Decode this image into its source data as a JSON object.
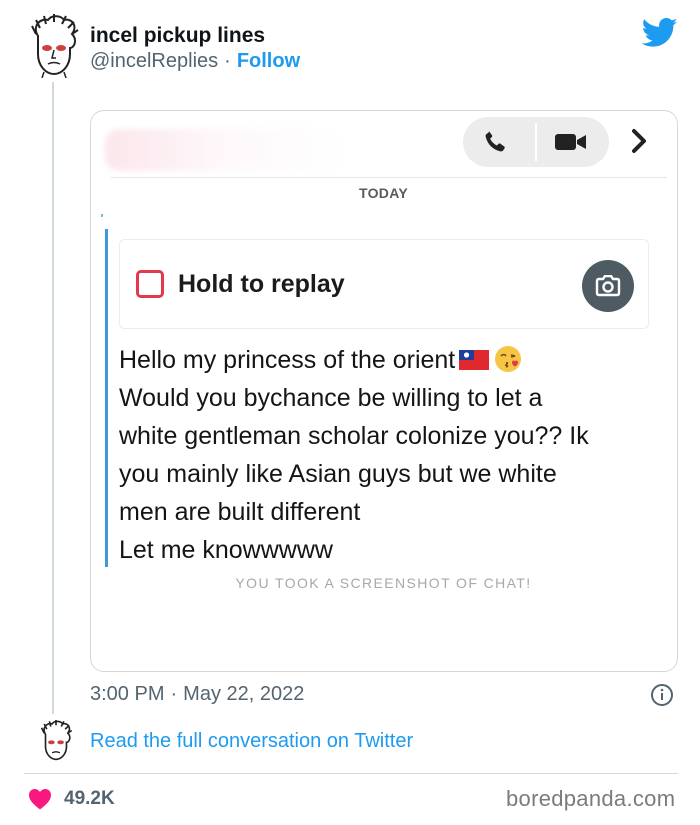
{
  "tweet": {
    "author_name": "incel pickup lines",
    "author_handle": "@incelReplies",
    "handle_separator": "·",
    "follow_label": "Follow",
    "time": "3:00 PM",
    "date_separator": "·",
    "date": "May 22, 2022",
    "read_more_label": "Read the full conversation on Twitter",
    "like_count": "49.2K",
    "brand_color": "#1d9bf0",
    "like_color": "#f91880"
  },
  "snap": {
    "day_label": "TODAY",
    "hold_label": "Hold to replay",
    "message_lines": [
      "Hello my princess of the orient",
      "Would you bychance be willing to let a",
      "white gentleman scholar colonize you?? Ik",
      "you mainly like Asian guys but we white",
      "men are built different",
      "Let me knowwwww"
    ],
    "message_emojis": [
      "taiwan-flag",
      "face-blowing-kiss"
    ],
    "screenshot_notice": "YOU TOOK A SCREENSHOT OF CHAT!",
    "accent_color": "#3e9bd3",
    "checkbox_color": "#e2394f"
  },
  "icons": {
    "brand": "twitter-bird-icon",
    "call": "phone-icon",
    "video": "video-camera-icon",
    "more": "chevron-right-icon",
    "camera": "camera-icon",
    "info": "info-icon",
    "like": "heart-icon"
  },
  "watermark": "boredpanda.com"
}
